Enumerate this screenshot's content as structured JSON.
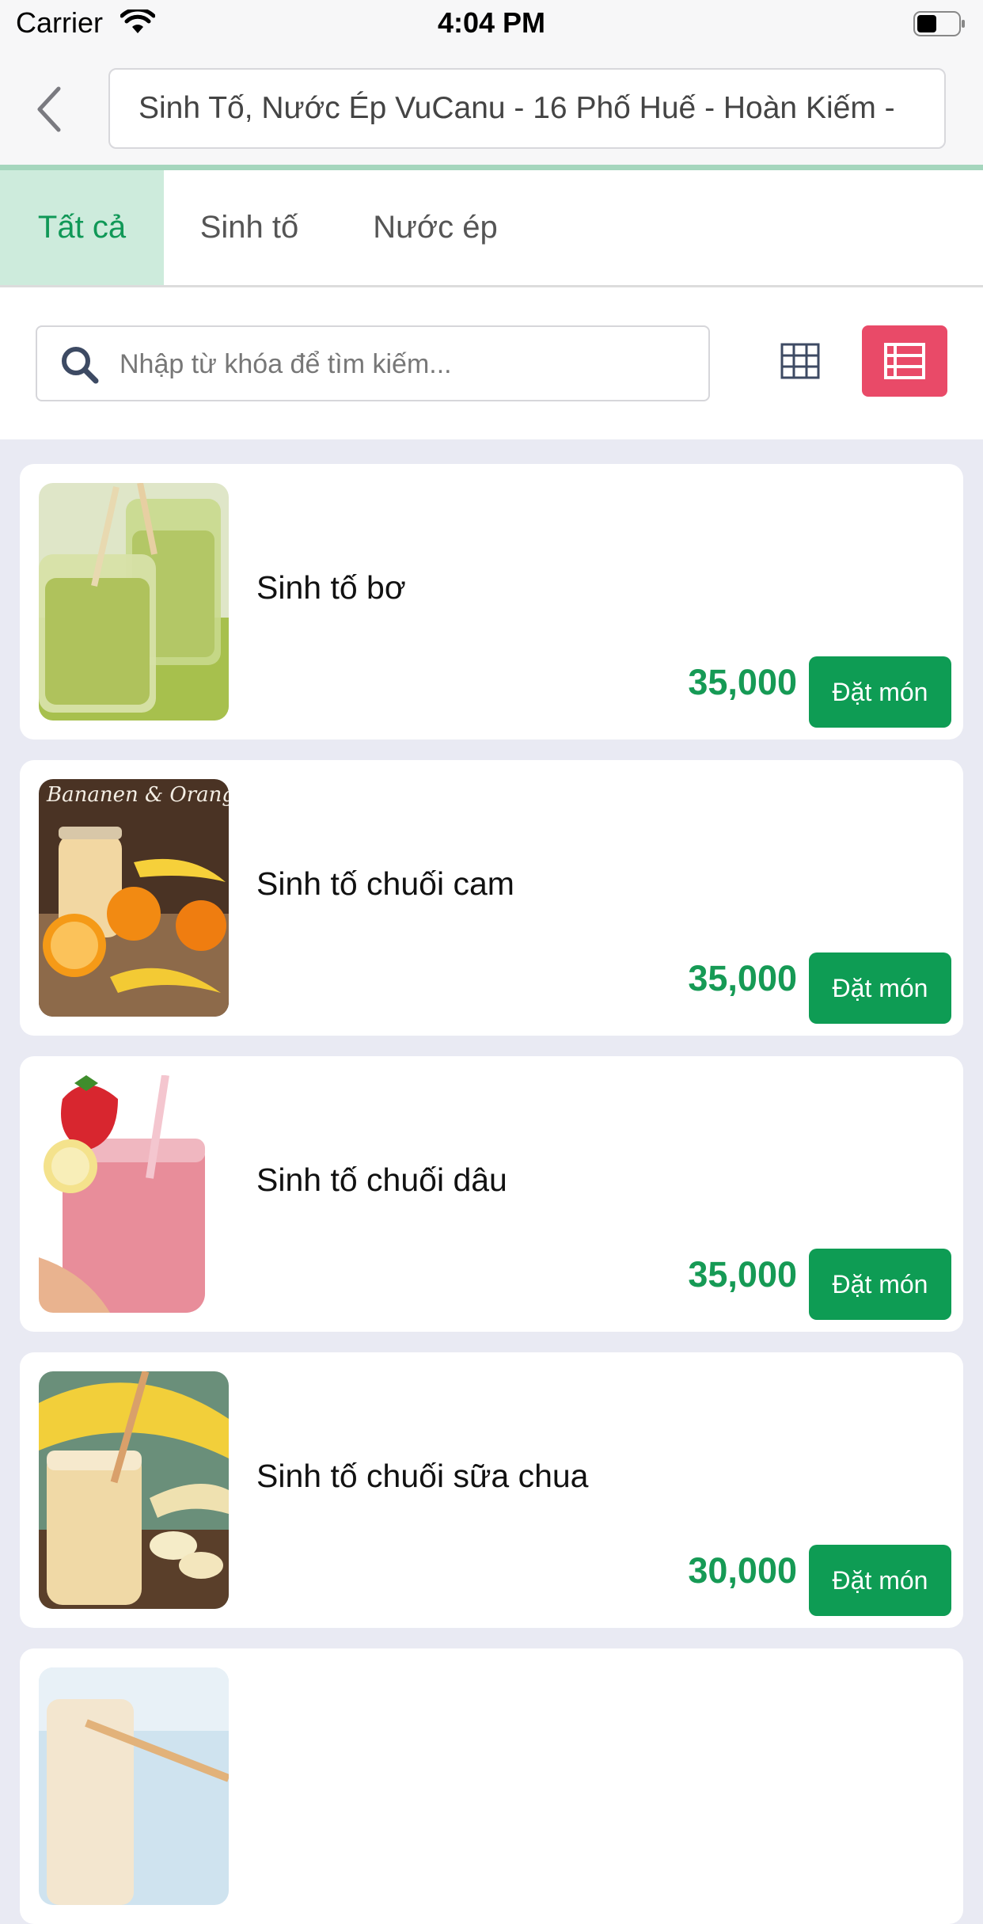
{
  "status_bar": {
    "carrier": "Carrier",
    "time": "4:04 PM"
  },
  "header": {
    "title": "Sinh Tố, Nước Ép VuCanu - 16 Phố Huế - Hoàn Kiếm -"
  },
  "tabs": [
    {
      "label": "Tất cả",
      "active": true
    },
    {
      "label": "Sinh tố",
      "active": false
    },
    {
      "label": "Nước ép",
      "active": false
    }
  ],
  "search": {
    "placeholder": "Nhập từ khóa để tìm kiếm...",
    "value": ""
  },
  "view_toggle": {
    "active": "list",
    "active_color": "#e94a68"
  },
  "accent_color": "#0e9c54",
  "items": [
    {
      "name": "Sinh tố bơ",
      "price": "35,000",
      "order_label": "Đặt món"
    },
    {
      "name": "Sinh tố chuối cam",
      "price": "35,000",
      "order_label": "Đặt món",
      "image_text": "Bananen & Orangen Smoothie"
    },
    {
      "name": "Sinh tố chuối dâu",
      "price": "35,000",
      "order_label": "Đặt món"
    },
    {
      "name": "Sinh tố chuối sữa chua",
      "price": "30,000",
      "order_label": "Đặt món"
    },
    {
      "name": "",
      "price": "",
      "order_label": ""
    }
  ]
}
